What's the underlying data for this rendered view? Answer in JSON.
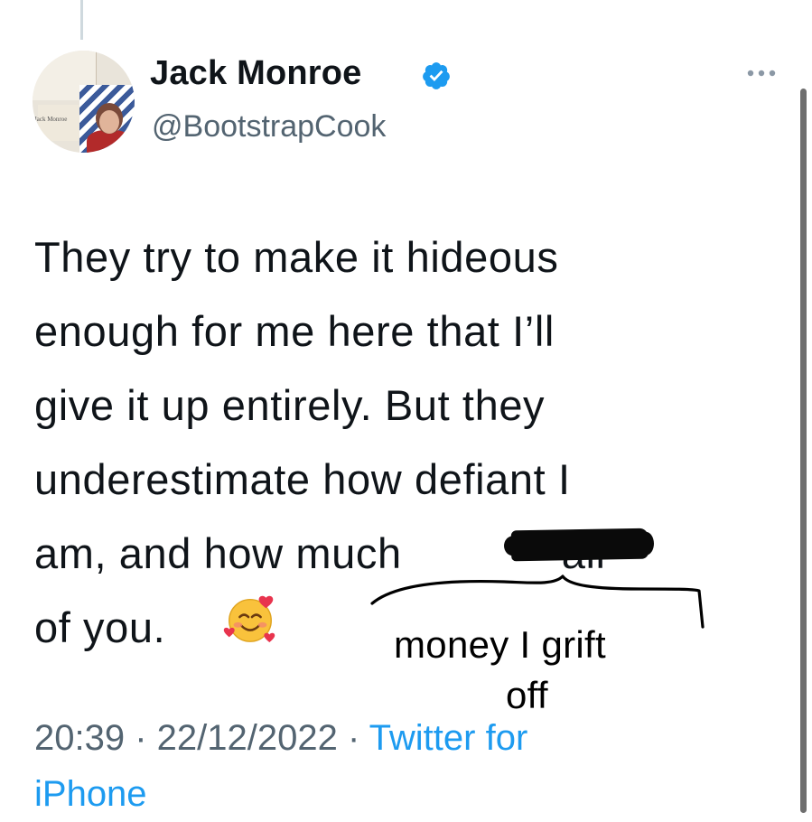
{
  "tweet": {
    "display_name": "Jack Monroe",
    "handle": "@BootstrapCook",
    "verified": true,
    "avatar_caption": "Jack Monroe",
    "text_lines": [
      "They try to make it hideous",
      "enough for me here that I’ll",
      "give it up entirely. But they",
      "underestimate how defiant I",
      "am, and how much",
      "all",
      "of you."
    ],
    "emoji": "smiling-face-with-hearts",
    "timestamp": "20:39 · 22/12/2022 · ",
    "source": "Twitter for",
    "source_line2": "iPhone"
  },
  "annotation": {
    "line1": "money I grift",
    "line2": "off"
  },
  "colors": {
    "text": "#0f1419",
    "secondary": "#536471",
    "link": "#1d9bf0",
    "verified": "#1d9bf0"
  }
}
